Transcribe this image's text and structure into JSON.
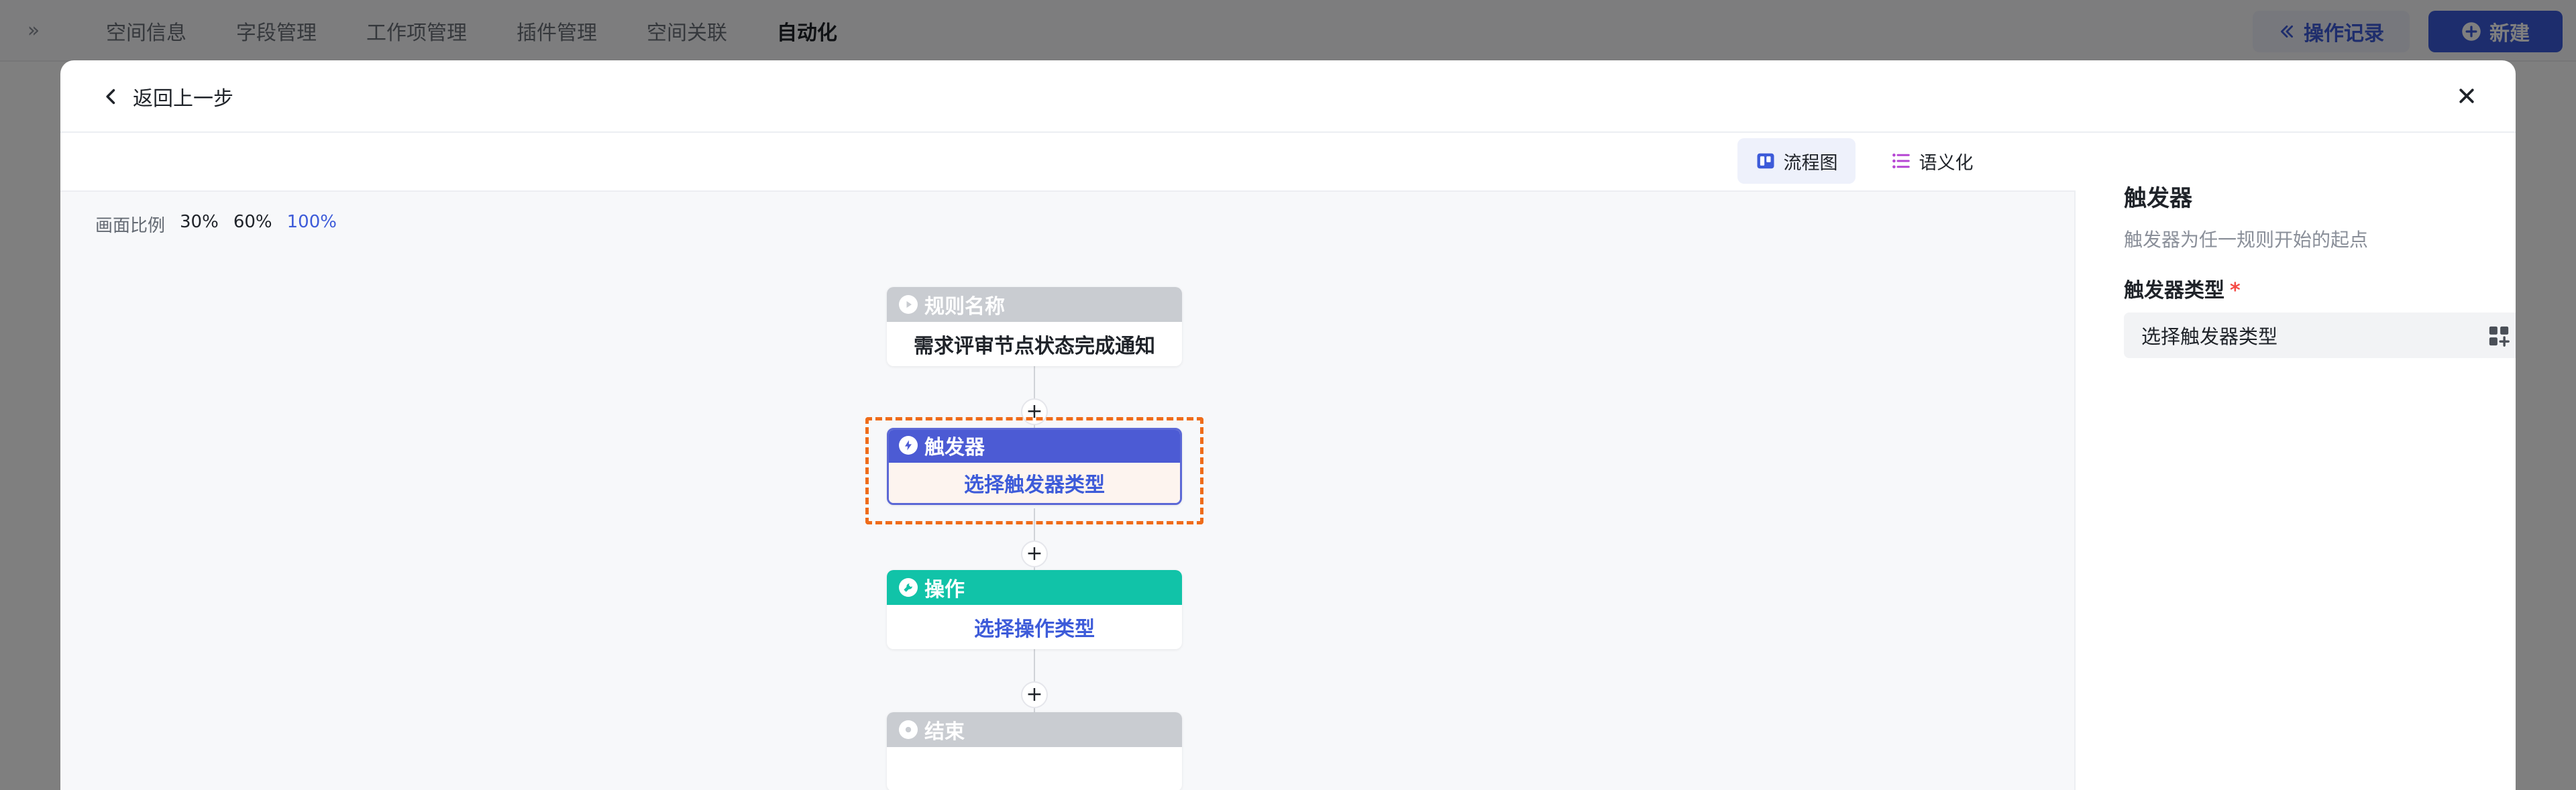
{
  "background": {
    "tabs": [
      {
        "label": "空间信息"
      },
      {
        "label": "字段管理"
      },
      {
        "label": "工作项管理"
      },
      {
        "label": "插件管理"
      },
      {
        "label": "空间关联"
      },
      {
        "label": "自动化",
        "active": true
      }
    ],
    "expand_icon": "»",
    "operation_log_label": "操作记录",
    "new_label": "新建"
  },
  "modal": {
    "back_label": "返回上一步",
    "view_toggle": {
      "flow_label": "流程图",
      "semantic_label": "语义化"
    },
    "zoom": {
      "label": "画面比例",
      "options": [
        "30%",
        "60%",
        "100%"
      ],
      "active": "100%"
    },
    "flow": {
      "rule_node": {
        "title": "规则名称",
        "value": "需求评审节点状态完成通知"
      },
      "trigger_node": {
        "title": "触发器",
        "value": "选择触发器类型"
      },
      "operation_node": {
        "title": "操作",
        "value": "选择操作类型"
      },
      "end_node": {
        "title": "结束",
        "value": ""
      },
      "add_symbol": "+"
    },
    "panel": {
      "title": "触发器",
      "description": "触发器为任一规则开始的起点",
      "field_label": "触发器类型",
      "required_mark": "*",
      "select_placeholder": "选择触发器类型"
    }
  },
  "colors": {
    "accent": "#3d5bd9",
    "trigger_header": "#4c5bd4",
    "operation_header": "#11c3a8",
    "neutral_header": "#c9ccd1",
    "selection_outline": "#ef6c1a"
  }
}
